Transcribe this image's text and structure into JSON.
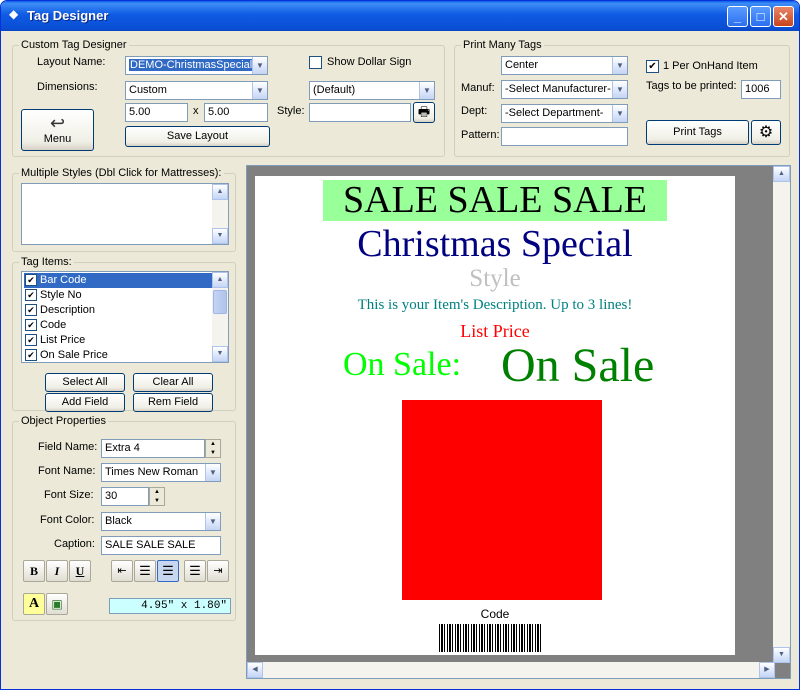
{
  "window": {
    "title": "Tag Designer",
    "min": "_",
    "max": "□",
    "close": "✕"
  },
  "custom_designer": {
    "group_label": "Custom Tag Designer",
    "layout_label": "Layout Name:",
    "layout_value": "DEMO-ChristmasSpecial",
    "dimensions_label": "Dimensions:",
    "dimensions_value": "Custom",
    "width_value": "5.00",
    "times": "x",
    "height_value": "5.00",
    "show_dollar_label": "Show Dollar Sign",
    "show_dollar_checked": false,
    "style_combo_value": "(Default)",
    "style_label": "Style:",
    "style_value": "",
    "menu_button": "Menu",
    "save_layout_button": "Save Layout"
  },
  "print_many": {
    "group_label": "Print Many Tags",
    "align_value": "Center",
    "one_per_label": "1 Per OnHand Item",
    "one_per_checked": true,
    "manuf_label": "Manuf:",
    "manuf_value": "-Select Manufacturer-",
    "tags_to_print_label": "Tags to be printed:",
    "tags_to_print_value": "1006",
    "dept_label": "Dept:",
    "dept_value": "-Select Department-",
    "pattern_label": "Pattern:",
    "pattern_value": "",
    "print_tags_button": "Print Tags"
  },
  "multiple_styles": {
    "group_label": "Multiple Styles (Dbl Click for Mattresses):"
  },
  "tag_items": {
    "group_label": "Tag Items:",
    "items": [
      {
        "label": "Bar Code",
        "checked": true,
        "selected": true
      },
      {
        "label": "Style No",
        "checked": true
      },
      {
        "label": "Description",
        "checked": true
      },
      {
        "label": "Code",
        "checked": true
      },
      {
        "label": "List Price",
        "checked": true
      },
      {
        "label": "On Sale Price",
        "checked": true
      }
    ],
    "select_all": "Select All",
    "clear_all": "Clear All",
    "add_field": "Add Field",
    "rem_field": "Rem Field"
  },
  "object_props": {
    "group_label": "Object Properties",
    "field_name_label": "Field Name:",
    "field_name_value": "Extra 4",
    "font_name_label": "Font Name:",
    "font_name_value": "Times New Roman",
    "font_size_label": "Font Size:",
    "font_size_value": "30",
    "font_color_label": "Font Color:",
    "font_color_value": "Black",
    "caption_label": "Caption:",
    "caption_value": "SALE   SALE  SALE",
    "bold": "B",
    "italic": "I",
    "underline": "U",
    "size_readout": "4.95\" x 1.80\""
  },
  "tag_preview": {
    "sale_banner": "SALE   SALE  SALE",
    "title": "Christmas Special",
    "style": "Style",
    "description": "This is your Item's Description.  Up to 3 lines!",
    "list_price": "List Price",
    "on_sale_label": "On Sale:",
    "on_sale_value": "On Sale",
    "code": "Code",
    "colors": {
      "banner_bg": "#99ff99",
      "title": "#000080",
      "style": "#c0c0c0",
      "description": "#008080",
      "list_price": "#ff0000",
      "on_sale_label": "#00ff00",
      "on_sale_value": "#008000",
      "image_box": "#ff0000"
    }
  }
}
